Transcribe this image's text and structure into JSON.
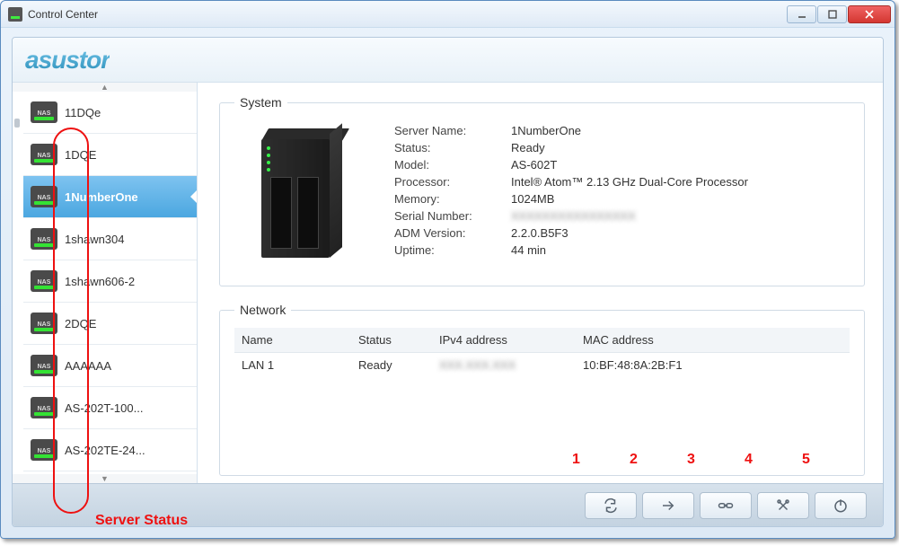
{
  "window": {
    "title": "Control Center"
  },
  "brand": "asustor",
  "sidebar": {
    "items": [
      {
        "label": "11DQe"
      },
      {
        "label": "1DQE"
      },
      {
        "label": "1NumberOne"
      },
      {
        "label": "1shawn304"
      },
      {
        "label": "1shawn606-2"
      },
      {
        "label": "2DQE"
      },
      {
        "label": "AAAAAA"
      },
      {
        "label": "AS-202T-100..."
      },
      {
        "label": "AS-202TE-24..."
      }
    ],
    "selected_index": 2,
    "nas_tag": "NAS"
  },
  "system": {
    "legend": "System",
    "fields": {
      "server_name_lbl": "Server Name:",
      "server_name": "1NumberOne",
      "status_lbl": "Status:",
      "status": "Ready",
      "model_lbl": "Model:",
      "model": "AS-602T",
      "processor_lbl": "Processor:",
      "processor": "Intel® Atom™ 2.13 GHz Dual-Core Processor",
      "memory_lbl": "Memory:",
      "memory": "1024MB",
      "serial_lbl": "Serial Number:",
      "serial": "XXXXXXXXXXXXXXXX",
      "adm_lbl": "ADM Version:",
      "adm": "2.2.0.B5F3",
      "uptime_lbl": "Uptime:",
      "uptime": "44 min"
    }
  },
  "network": {
    "legend": "Network",
    "headers": {
      "name": "Name",
      "status": "Status",
      "ipv4": "IPv4 address",
      "mac": "MAC address"
    },
    "rows": [
      {
        "name": "LAN 1",
        "status": "Ready",
        "ipv4": "XXX.XXX.XXX",
        "mac": "10:BF:48:8A:2B:F1"
      }
    ]
  },
  "annotations": {
    "server_status": "Server Status",
    "numbers": [
      "1",
      "2",
      "3",
      "4",
      "5"
    ]
  }
}
